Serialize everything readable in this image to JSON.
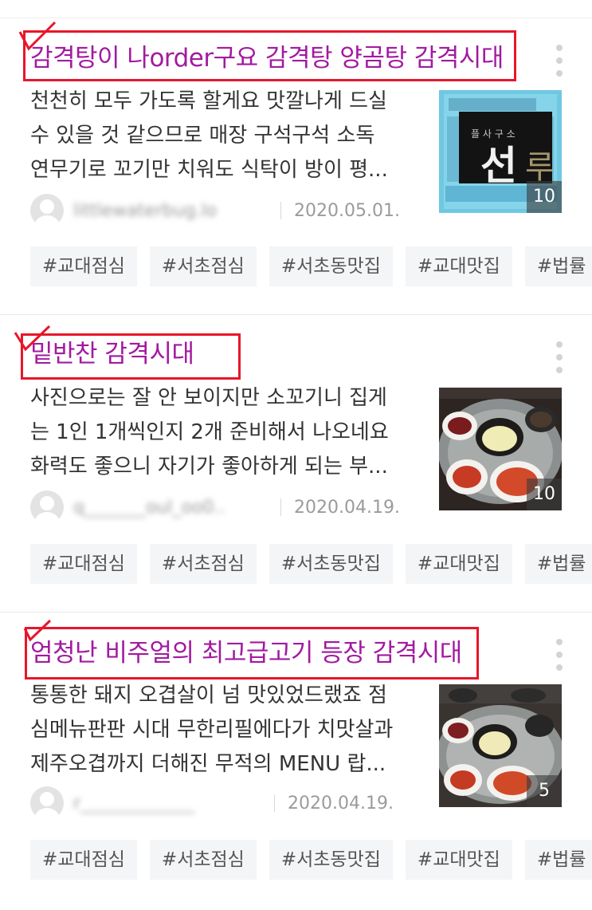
{
  "posts": [
    {
      "title": "감격탕이 나order구요 감격탕 양곰탕 감격시대",
      "desc_lines": [
        "천천히 모두 가도록 할게요 맛깔나게 드실",
        "수 있을 것 같으므로 매장 구석구석 소독",
        "연무기로 꼬기만 치워도 식탁이 방이 평..."
      ],
      "author": "littlewaterbug.lo",
      "date": "2020.05.01.",
      "photo_count": "10",
      "tags": [
        "#교대점심",
        "#서초점심",
        "#서초동맛집",
        "#교대맛집",
        "#법률"
      ]
    },
    {
      "title": "밑반찬 감격시대",
      "desc_lines": [
        "사진으로는 잘 안 보이지만 소꼬기니 집게",
        "는 1인 1개씩인지 2개 준비해서 나오네요",
        "화력도 좋으니 자기가 좋아하게 되는 부..."
      ],
      "author": "q_______oul_oo0..",
      "date": "2020.04.19.",
      "photo_count": "10",
      "tags": [
        "#교대점심",
        "#서초점심",
        "#서초동맛집",
        "#교대맛집",
        "#법률"
      ]
    },
    {
      "title": "엄청난 비주얼의 최고급고기 등장 감격시대",
      "desc_lines": [
        "통통한 돼지 오겹살이 넘 맛있었드랬죠 점",
        "심메뉴판판 시대 무한리필에다가 치맛살과",
        "제주오겹까지 더해진 무적의 MENU 랍..."
      ],
      "author": "r_____________",
      "date": "2020.04.19.",
      "photo_count": "5",
      "tags": [
        "#교대점심",
        "#서초점심",
        "#서초동맛집",
        "#교대맛집",
        "#법률"
      ]
    }
  ],
  "thumb1_sign_text": "선",
  "colors": {
    "title": "#a21aa0",
    "annotation_red": "#e8162a",
    "tag_bg": "#f4f5f7"
  },
  "icons": [
    "more-vertical-icon",
    "avatar-placeholder-icon",
    "check-annotation-icon"
  ]
}
